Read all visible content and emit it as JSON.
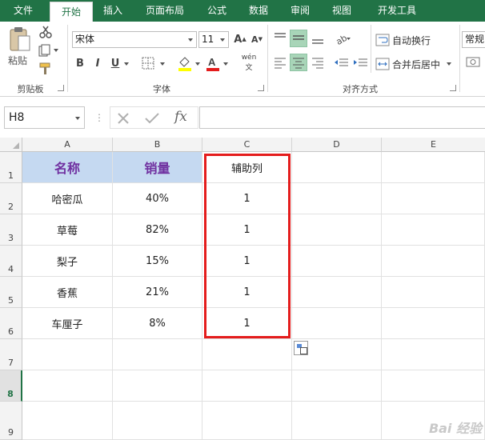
{
  "tabs": [
    "文件",
    "开始",
    "插入",
    "页面布局",
    "公式",
    "数据",
    "审阅",
    "视图",
    "开发工具"
  ],
  "ribbon": {
    "clipboard": {
      "paste_label": "粘贴",
      "group_label": "剪贴板"
    },
    "font": {
      "name": "宋体",
      "size": "11",
      "bold": "B",
      "italic": "I",
      "underline": "U",
      "increase": "A",
      "decrease": "A",
      "phonetic": "wén",
      "group_label": "字体"
    },
    "alignment": {
      "wrap_text": "自动换行",
      "merge_center": "合并后居中",
      "group_label": "对齐方式"
    },
    "number": {
      "format": "常规"
    }
  },
  "formula_bar": {
    "name_box": "H8",
    "fx": "fx",
    "value": ""
  },
  "columns": [
    "A",
    "B",
    "C",
    "D",
    "E"
  ],
  "rows": [
    "1",
    "2",
    "3",
    "4",
    "5",
    "6",
    "7",
    "8",
    "9"
  ],
  "selected_row": "8",
  "table": {
    "headers": [
      "名称",
      "销量",
      "辅助列"
    ],
    "rows": [
      [
        "哈密瓜",
        "40%",
        "1"
      ],
      [
        "草莓",
        "82%",
        "1"
      ],
      [
        "梨子",
        "15%",
        "1"
      ],
      [
        "香蕉",
        "21%",
        "1"
      ],
      [
        "车厘子",
        "8%",
        "1"
      ]
    ]
  },
  "colors": {
    "excel_green": "#217346",
    "header_fill": "#c5d9f1",
    "header_text": "#7030a0",
    "highlight": "#e41c1c"
  },
  "watermark": "Bai 经验"
}
